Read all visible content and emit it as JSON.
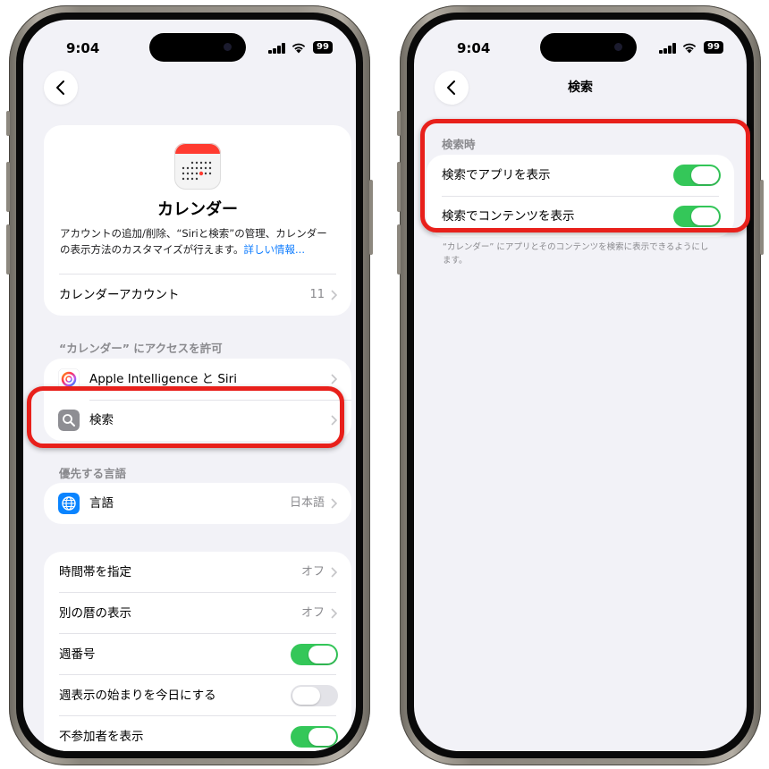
{
  "left_screen": {
    "status": {
      "time": "9:04",
      "battery": "99"
    },
    "app_card": {
      "title": "カレンダー",
      "description": "アカウントの追加/削除、“Siriと検索”の管理、カレンダーの表示方法のカスタマイズが行えます。",
      "link": "詳しい情報...",
      "account_row": {
        "label": "カレンダーアカウント",
        "value": "11"
      }
    },
    "access_section": {
      "header": "“カレンダー” にアクセスを許可",
      "items": [
        {
          "label": "Apple Intelligence と Siri",
          "icon": "apple-intelligence-siri-icon"
        },
        {
          "label": "検索",
          "icon": "search-icon"
        }
      ]
    },
    "language_section": {
      "header": "優先する言語",
      "row": {
        "label": "言語",
        "value": "日本語",
        "icon": "globe-icon"
      }
    },
    "settings_rows": [
      {
        "label": "時間帯を指定",
        "value": "オフ",
        "type": "chevron"
      },
      {
        "label": "別の暦の表示",
        "value": "オフ",
        "type": "chevron"
      },
      {
        "label": "週番号",
        "type": "toggle",
        "on": true
      },
      {
        "label": "週表示の始まりを今日にする",
        "type": "toggle",
        "on": false
      },
      {
        "label": "不参加者を表示",
        "type": "toggle",
        "on": true
      }
    ]
  },
  "right_screen": {
    "status": {
      "time": "9:04",
      "battery": "99"
    },
    "nav_title": "検索",
    "section_header": "検索時",
    "rows": [
      {
        "label": "検索でアプリを表示",
        "on": true
      },
      {
        "label": "検索でコンテンツを表示",
        "on": true
      }
    ],
    "footnote": "“カレンダー” にアプリとそのコンテンツを検索に表示できるようにします。"
  },
  "colors": {
    "toggle_on": "#34c759",
    "highlight": "#e8201b",
    "link": "#0a7aff",
    "background": "#f2f2f7"
  }
}
